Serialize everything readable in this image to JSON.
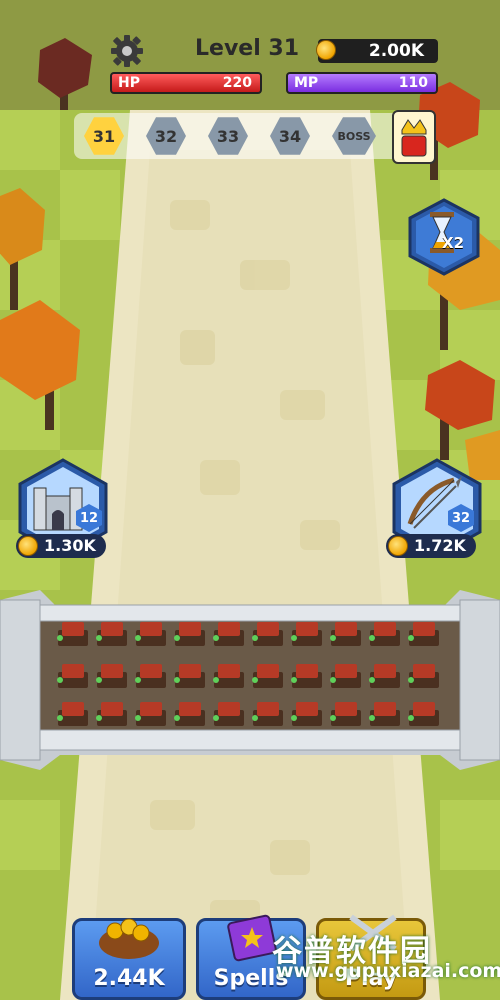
{
  "hud": {
    "level_text": "Level 31",
    "gold": "2.00K",
    "hp_label": "HP",
    "hp_value": "220",
    "mp_label": "MP",
    "mp_value": "110"
  },
  "stages": {
    "items": [
      "31",
      "32",
      "33",
      "34",
      "BOSS"
    ],
    "current_index": 0
  },
  "speed_boost": {
    "label": "X2",
    "icon": "hourglass-icon"
  },
  "upgrades": {
    "castle": {
      "level": "12",
      "cost": "1.30K",
      "icon": "castle-icon"
    },
    "archer": {
      "level": "32",
      "cost": "1.72K",
      "icon": "bow-icon"
    }
  },
  "bottom_bar": {
    "gold_button": "2.44K",
    "spells_button": "Spells",
    "play_button": "Play"
  },
  "watermark": {
    "text_cn": "谷普软件园",
    "url": "www.gupuxiazai.com"
  },
  "colors": {
    "grass": "#a8c24a",
    "road": "#ece5c2",
    "wall": "#d8dde2",
    "hp": "#d92a2a",
    "mp": "#8a3cf0",
    "accent": "#3266c8"
  }
}
